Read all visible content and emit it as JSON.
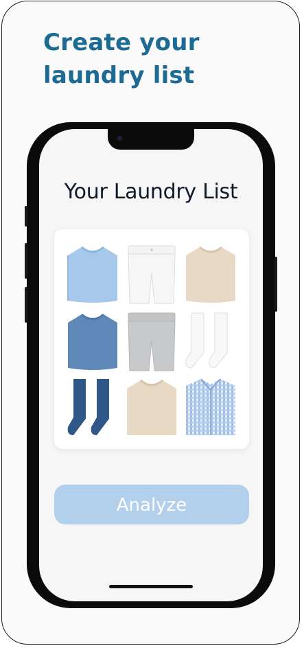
{
  "headline": {
    "line1": "Create your",
    "line2": "laundry list"
  },
  "screen": {
    "title": "Your Laundry List",
    "items": [
      {
        "icon": "light-blue-tshirt-icon"
      },
      {
        "icon": "white-shorts-icon"
      },
      {
        "icon": "beige-tshirt-icon"
      },
      {
        "icon": "blue-tshirt-icon"
      },
      {
        "icon": "gray-shorts-icon"
      },
      {
        "icon": "white-socks-icon"
      },
      {
        "icon": "navy-socks-icon"
      },
      {
        "icon": "beige-sweater-icon"
      },
      {
        "icon": "checkered-shirt-icon"
      }
    ],
    "analyze_label": "Analyze"
  },
  "colors": {
    "headline": "#1d6a93",
    "button": "#b2cfec",
    "light_blue": "#a6c8ea",
    "blue": "#5d88b8",
    "navy": "#2f5788",
    "beige": "#e8d9c4",
    "gray": "#c7c9cb"
  }
}
